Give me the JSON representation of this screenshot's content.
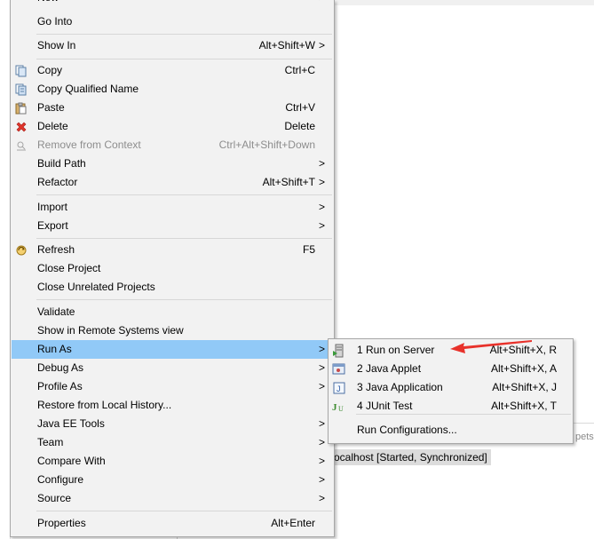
{
  "menu": {
    "items": [
      {
        "label": "New",
        "accel": "",
        "arrow": ">"
      },
      {
        "label": "Go Into",
        "accel": "",
        "arrow": ""
      },
      {
        "label": "Show In",
        "accel": "Alt+Shift+W",
        "arrow": ">"
      },
      {
        "label": "Copy",
        "accel": "Ctrl+C",
        "arrow": ""
      },
      {
        "label": "Copy Qualified Name",
        "accel": "",
        "arrow": ""
      },
      {
        "label": "Paste",
        "accel": "Ctrl+V",
        "arrow": ""
      },
      {
        "label": "Delete",
        "accel": "Delete",
        "arrow": ""
      },
      {
        "label": "Remove from Context",
        "accel": "Ctrl+Alt+Shift+Down",
        "arrow": ""
      },
      {
        "label": "Build Path",
        "accel": "",
        "arrow": ">"
      },
      {
        "label": "Refactor",
        "accel": "Alt+Shift+T",
        "arrow": ">"
      },
      {
        "label": "Import",
        "accel": "",
        "arrow": ">"
      },
      {
        "label": "Export",
        "accel": "",
        "arrow": ">"
      },
      {
        "label": "Refresh",
        "accel": "F5",
        "arrow": ""
      },
      {
        "label": "Close Project",
        "accel": "",
        "arrow": ""
      },
      {
        "label": "Close Unrelated Projects",
        "accel": "",
        "arrow": ""
      },
      {
        "label": "Validate",
        "accel": "",
        "arrow": ""
      },
      {
        "label": "Show in Remote Systems view",
        "accel": "",
        "arrow": ""
      },
      {
        "label": "Run As",
        "accel": "",
        "arrow": ">"
      },
      {
        "label": "Debug As",
        "accel": "",
        "arrow": ">"
      },
      {
        "label": "Profile As",
        "accel": "",
        "arrow": ">"
      },
      {
        "label": "Restore from Local History...",
        "accel": "",
        "arrow": ""
      },
      {
        "label": "Java EE Tools",
        "accel": "",
        "arrow": ">"
      },
      {
        "label": "Team",
        "accel": "",
        "arrow": ">"
      },
      {
        "label": "Compare With",
        "accel": "",
        "arrow": ">"
      },
      {
        "label": "Configure",
        "accel": "",
        "arrow": ">"
      },
      {
        "label": "Source",
        "accel": "",
        "arrow": ">"
      },
      {
        "label": "Properties",
        "accel": "Alt+Enter",
        "arrow": ""
      }
    ]
  },
  "submenu": {
    "items": [
      {
        "label": "1 Run on Server",
        "accel": "Alt+Shift+X, R"
      },
      {
        "label": "2 Java Applet",
        "accel": "Alt+Shift+X, A"
      },
      {
        "label": "3 Java Application",
        "accel": "Alt+Shift+X, J"
      },
      {
        "label": "4 JUnit Test",
        "accel": "Alt+Shift+X, T"
      },
      {
        "label": "Run Configurations...",
        "accel": ""
      }
    ]
  },
  "background": {
    "server_status": "ocalhost  [Started, Synchronized]",
    "tab_fragment": "pets"
  },
  "colors": {
    "highlight": "#91c9f7",
    "menu_bg": "#f2f2f2",
    "arrow_red": "#e8322b"
  }
}
